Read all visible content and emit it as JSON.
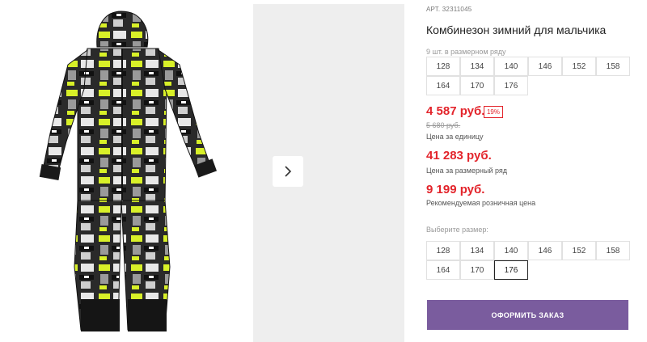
{
  "product": {
    "image_alt": "winter jumpsuit with graffiti print",
    "art_prefix": "АРТ.",
    "art_number": "32311045",
    "title": "Комбинезон зимний для мальчика",
    "pack_label": "9 шт. в размерном ряду",
    "pack_sizes": [
      "128",
      "134",
      "140",
      "146",
      "152",
      "158",
      "164",
      "170",
      "176"
    ]
  },
  "pricing": {
    "unit_price": "4 587 руб.",
    "discount_badge": "19%",
    "old_price": "5 680 руб.",
    "unit_caption": "Цена за единицу",
    "range_price": "41 283 руб.",
    "range_caption": "Цена за размерный ряд",
    "retail_price": "9 199 руб.",
    "retail_caption": "Рекомендуемая розничная цена"
  },
  "size_select": {
    "label": "Выберите размер:",
    "sizes": [
      "128",
      "134",
      "140",
      "146",
      "152",
      "158",
      "164",
      "170",
      "176"
    ],
    "selected": "176"
  },
  "order_button": {
    "label": "ОФОРМИТЬ ЗАКАЗ"
  },
  "colors": {
    "price_red": "#e3242b",
    "order_button_bg": "#7a5c9e",
    "gallery_bg": "#eeeeee",
    "print_lime": "#d8f028"
  },
  "icons": {
    "next": "chevron-right-icon"
  }
}
